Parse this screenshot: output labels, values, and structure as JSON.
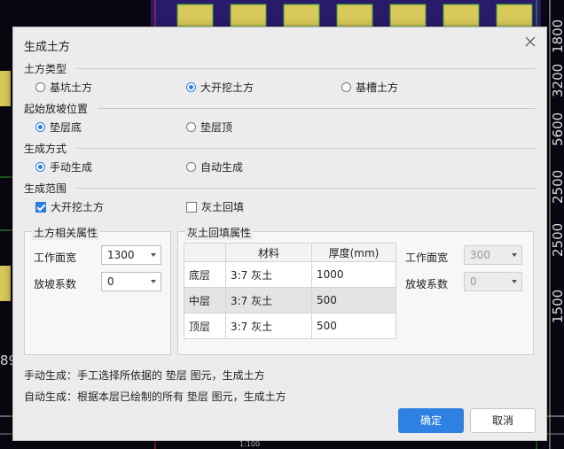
{
  "dialog": {
    "title": "生成土方",
    "close_icon": "close-icon"
  },
  "earth_type": {
    "label": "土方类型",
    "options": [
      {
        "label": "基坑土方",
        "checked": false
      },
      {
        "label": "大开挖土方",
        "checked": true
      },
      {
        "label": "基槽土方",
        "checked": false
      }
    ]
  },
  "slope_start": {
    "label": "起始放坡位置",
    "options": [
      {
        "label": "垫层底",
        "checked": true
      },
      {
        "label": "垫层顶",
        "checked": false
      }
    ]
  },
  "gen_mode": {
    "label": "生成方式",
    "options": [
      {
        "label": "手动生成",
        "checked": true
      },
      {
        "label": "自动生成",
        "checked": false
      }
    ]
  },
  "gen_range": {
    "label": "生成范围",
    "options": [
      {
        "label": "大开挖土方",
        "checked": true
      },
      {
        "label": "灰土回填",
        "checked": false
      }
    ]
  },
  "earth_props": {
    "label": "土方相关属性",
    "work_width_label": "工作面宽",
    "work_width_value": "1300",
    "slope_coef_label": "放坡系数",
    "slope_coef_value": "0"
  },
  "backfill_props": {
    "label": "灰土回填属性",
    "columns": [
      "材料",
      "厚度(mm)"
    ],
    "rows": [
      {
        "name": "底层",
        "material": "3:7 灰土",
        "thickness": "1000"
      },
      {
        "name": "中层",
        "material": "3:7 灰土",
        "thickness": "500"
      },
      {
        "name": "顶层",
        "material": "3:7 灰土",
        "thickness": "500"
      }
    ],
    "work_width_label": "工作面宽",
    "work_width_value": "300",
    "slope_coef_label": "放坡系数",
    "slope_coef_value": "0"
  },
  "notes": {
    "manual": "手动生成：手工选择所依据的 垫层 图元，生成土方",
    "auto": "自动生成：根据本层已绘制的所有 垫层 图元，生成土方"
  },
  "buttons": {
    "ok": "确定",
    "cancel": "取消"
  },
  "cad_background": {
    "dims": [
      "1800",
      "3200",
      "5600",
      "2500",
      "2500",
      "1500"
    ],
    "left_numbers": [
      "89"
    ],
    "bottom_labels": [
      "1:100"
    ]
  },
  "colors": {
    "accent": "#2f80e3",
    "dialog_bg": "#ececec",
    "cad_bg": "#0a0612"
  }
}
